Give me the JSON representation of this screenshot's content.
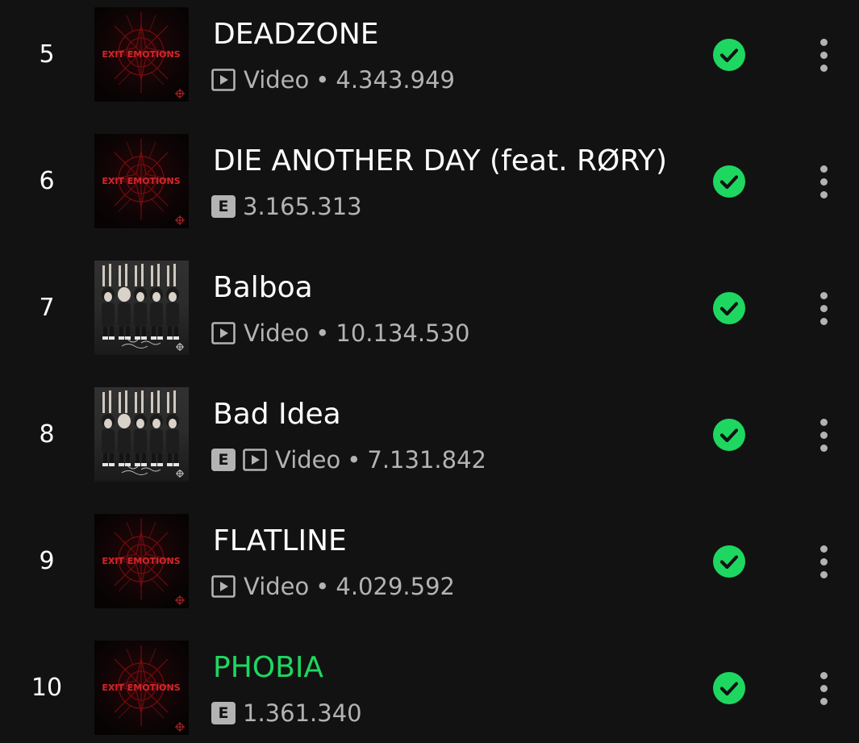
{
  "tracks": [
    {
      "number": "5",
      "title": "DEADZONE",
      "explicit": false,
      "video": true,
      "video_label": "Video",
      "separator": "•",
      "plays": "4.343.949",
      "playing": false,
      "cover": "exit-emotions",
      "cover_text": "EXIT EMOTIONS"
    },
    {
      "number": "6",
      "title": "DIE ANOTHER DAY (feat. RØRY)",
      "explicit": true,
      "explicit_label": "E",
      "video": false,
      "plays": "3.165.313",
      "playing": false,
      "cover": "exit-emotions",
      "cover_text": "EXIT EMOTIONS"
    },
    {
      "number": "7",
      "title": "Balboa",
      "explicit": false,
      "video": true,
      "video_label": "Video",
      "separator": "•",
      "plays": "10.134.530",
      "playing": false,
      "cover": "band-photo"
    },
    {
      "number": "8",
      "title": "Bad Idea",
      "explicit": true,
      "explicit_label": "E",
      "video": true,
      "video_label": "Video",
      "separator": "•",
      "plays": "7.131.842",
      "playing": false,
      "cover": "band-photo"
    },
    {
      "number": "9",
      "title": "FLATLINE",
      "explicit": false,
      "video": true,
      "video_label": "Video",
      "separator": "•",
      "plays": "4.029.592",
      "playing": false,
      "cover": "exit-emotions",
      "cover_text": "EXIT EMOTIONS"
    },
    {
      "number": "10",
      "title": "PHOBIA",
      "explicit": true,
      "explicit_label": "E",
      "video": false,
      "plays": "1.361.340",
      "playing": true,
      "cover": "exit-emotions",
      "cover_text": "EXIT EMOTIONS"
    }
  ],
  "colors": {
    "background": "#121212",
    "accent_green": "#1ed760",
    "secondary_text": "#b3b3b3",
    "primary_text": "#ffffff"
  },
  "icons": {
    "downloaded": "check-circle-icon",
    "more": "more-vertical-icon",
    "video": "video-play-icon",
    "explicit": "explicit-badge-icon"
  }
}
